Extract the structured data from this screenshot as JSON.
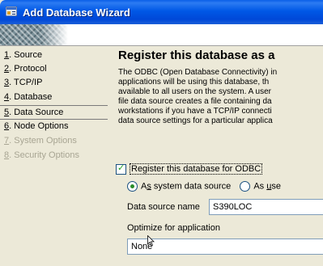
{
  "window": {
    "title": "Add Database Wizard"
  },
  "nav": {
    "items": [
      {
        "key": "1",
        "rest": ". Source",
        "disabled": false,
        "selected": false
      },
      {
        "key": "2",
        "rest": ". Protocol",
        "disabled": false,
        "selected": false
      },
      {
        "key": "3",
        "rest": ". TCP/IP",
        "disabled": false,
        "selected": false
      },
      {
        "key": "4",
        "rest": ". Database",
        "disabled": false,
        "selected": false
      },
      {
        "key": "5",
        "rest": ". Data Source",
        "disabled": false,
        "selected": true
      },
      {
        "key": "6",
        "rest": ". Node Options",
        "disabled": false,
        "selected": false
      },
      {
        "key": "7",
        "rest": ". System Options",
        "disabled": true,
        "selected": false
      },
      {
        "key": "8",
        "rest": ". Security Options",
        "disabled": true,
        "selected": false
      }
    ]
  },
  "main": {
    "heading": "Register this database as a",
    "description": [
      "The ODBC (Open Database Connectivity) in",
      "applications will be using this database, th",
      "available to all users on the system. A user",
      "file data source creates a file containing da",
      "workstations if you have a TCP/IP connecti",
      "data source settings for a particular applica"
    ],
    "register_checkbox": {
      "label": "Register this database for ODBC",
      "checked": true
    },
    "radio_system": {
      "pre": "A",
      "key": "s",
      "post": " system data source",
      "selected": true
    },
    "radio_user": {
      "pre": "As ",
      "key": "u",
      "post": "se",
      "selected": false
    },
    "datasource_label": "Data source name",
    "datasource_value": "S390LOC",
    "optimize_label": "Optimize for application",
    "optimize_value": "None"
  }
}
